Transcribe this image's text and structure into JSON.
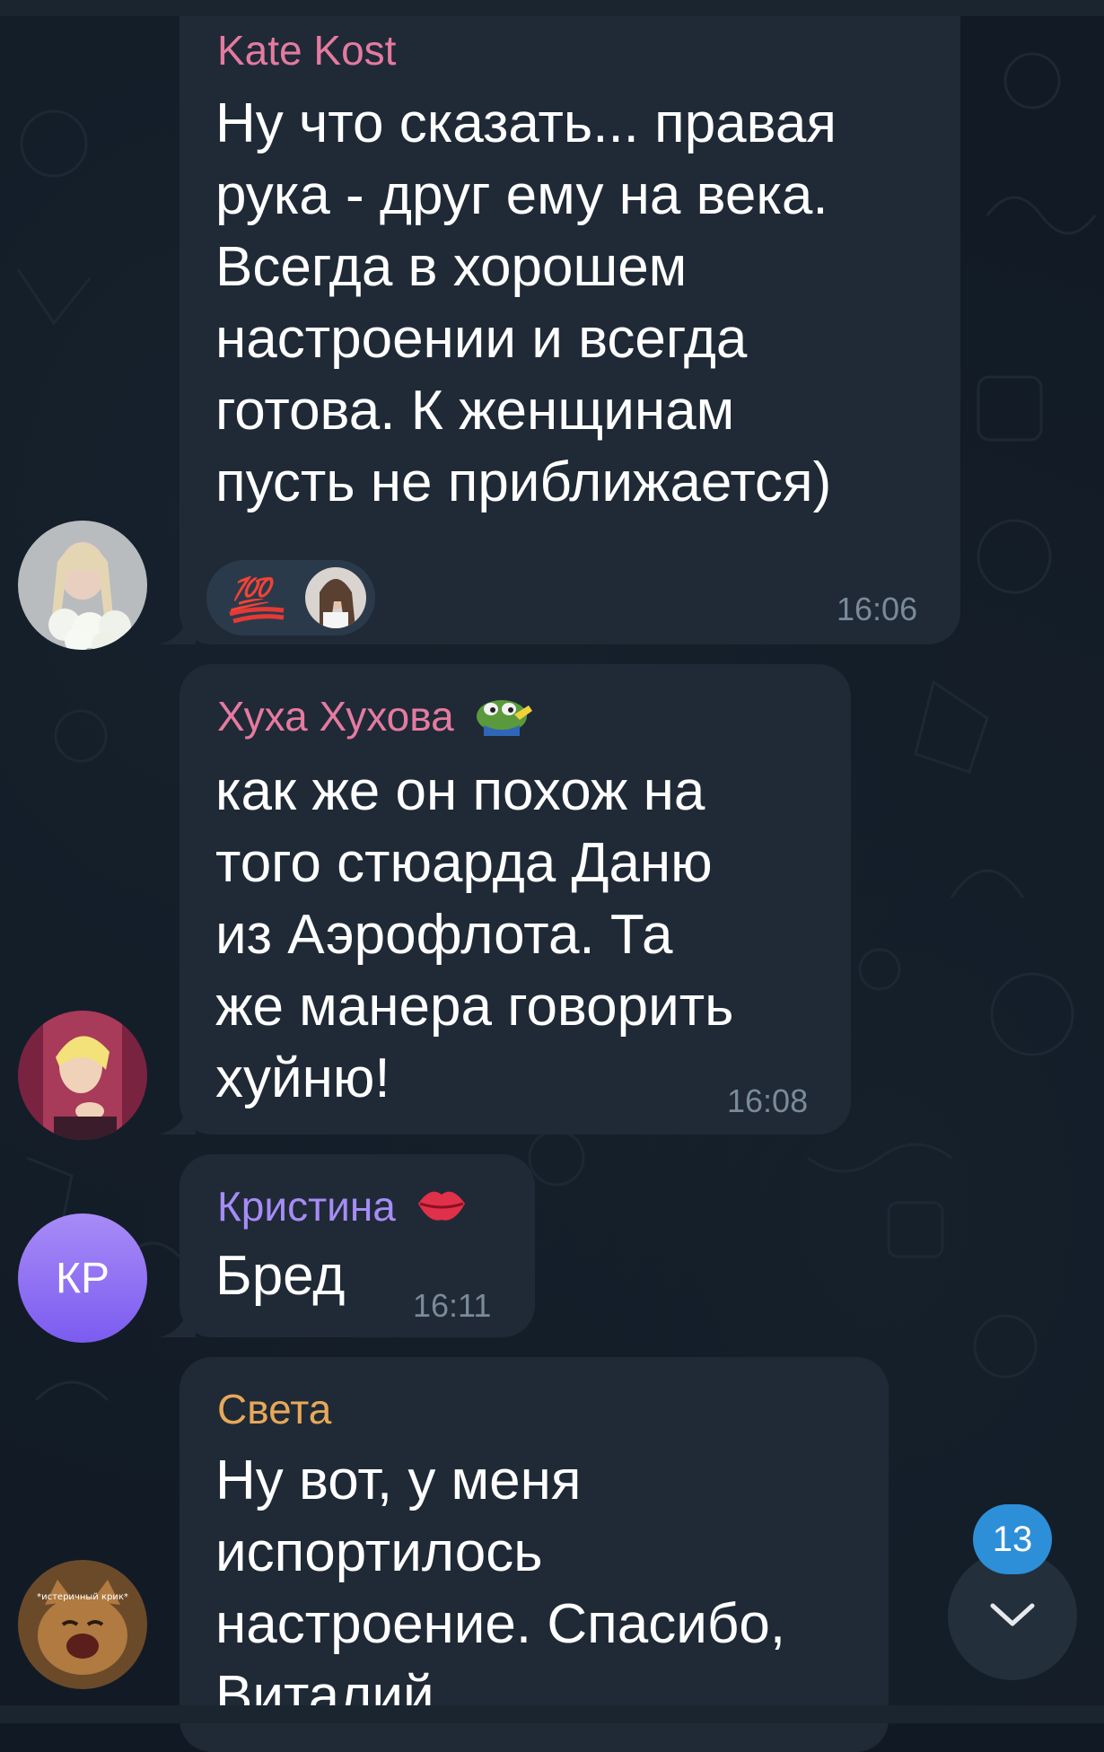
{
  "messages": [
    {
      "sender": "Kate Kost",
      "sender_color": "#e57aa0",
      "lines": [
        "Ну что сказать... правая",
        "рука - друг ему на века.",
        "Всегда в хорошем",
        "настроении и всегда",
        "готова. К женщинам",
        "пусть не приближается)"
      ],
      "reaction": "💯",
      "time": "16:06"
    },
    {
      "sender": "Хуха Хухова",
      "sender_color": "#e57aa0",
      "sender_icon": "pepe-frog-emoji",
      "lines": [
        "как же он похож на",
        "того стюарда Даню",
        "из Аэрофлота. Та",
        "же манера говорить",
        "хуйню!"
      ],
      "time": "16:08"
    },
    {
      "sender": "Кристина",
      "sender_color": "#a68cf5",
      "sender_icon": "lips-emoji",
      "avatar_initials": "КР",
      "lines": [
        "Бред"
      ],
      "time": "16:11"
    },
    {
      "sender": "Света",
      "sender_color": "#e8a85a",
      "avatar_caption": "*истеричный крик*",
      "lines": [
        "Ну вот, у меня",
        "испортилось",
        "настроение. Спасибо,",
        "Виталий"
      ]
    }
  ],
  "unread_count": "13",
  "colors": {
    "bubble": "#1f2a36",
    "background": "#121b25",
    "badge": "#2d8fd8"
  }
}
